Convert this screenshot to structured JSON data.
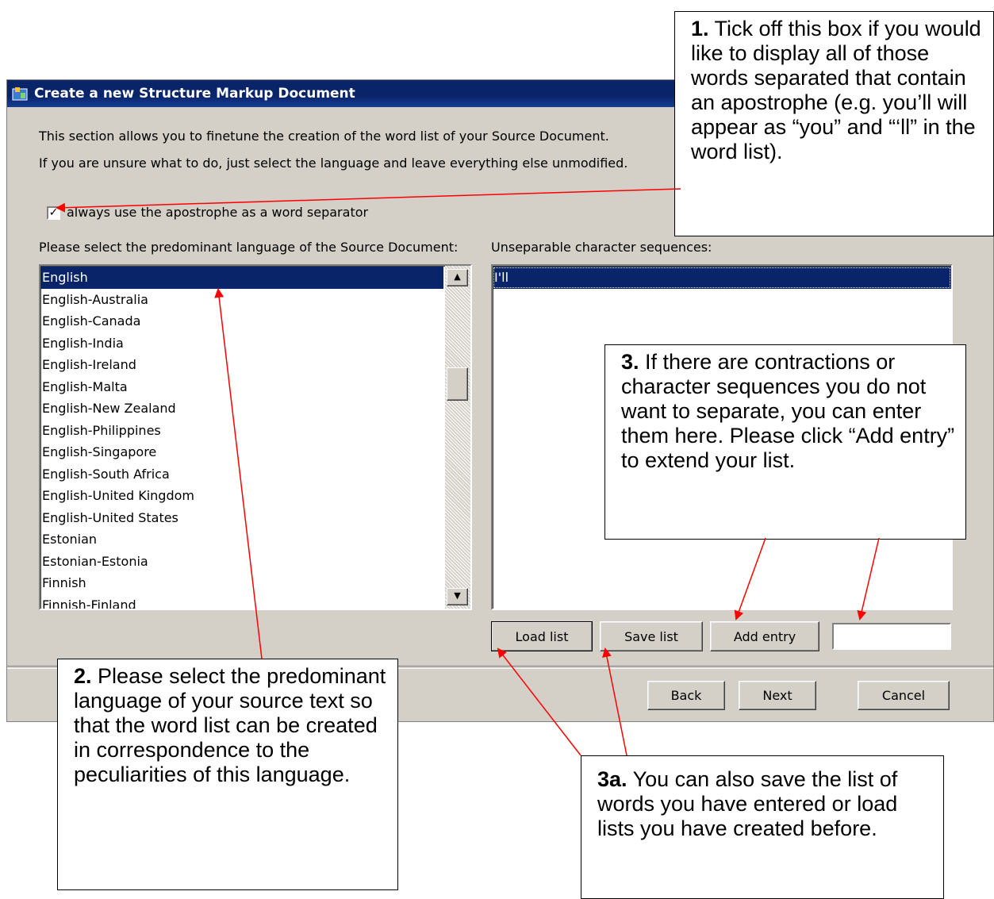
{
  "window": {
    "title": "Create a new Structure Markup Document"
  },
  "intro": {
    "line1": "This section allows you to finetune the creation of the word list of your Source Document.",
    "line2": "If you are unsure what to do, just select the language and leave everything else unmodified."
  },
  "apostrophe_option": {
    "label": "always use the apostrophe as a word separator",
    "checked": true,
    "check_glyph": "✓"
  },
  "language_panel": {
    "label": "Please select the predominant language of the Source Document:",
    "items": [
      "English",
      "English-Australia",
      "English-Canada",
      "English-India",
      "English-Ireland",
      "English-Malta",
      "English-New Zealand",
      "English-Philippines",
      "English-Singapore",
      "English-South Africa",
      "English-United Kingdom",
      "English-United States",
      "Estonian",
      "Estonian-Estonia",
      "Finnish",
      "Finnish-Finland"
    ],
    "selected": "English"
  },
  "sequences_panel": {
    "label": "Unseparable character sequences:",
    "items": [
      "I'll"
    ]
  },
  "list_buttons": {
    "load": "Load list",
    "save": "Save list",
    "add": "Add entry",
    "entry_value": ""
  },
  "nav_buttons": {
    "back": "Back",
    "next": "Next",
    "cancel": "Cancel"
  },
  "callouts": {
    "c1_num": "1.",
    "c1_text": "Tick off this box if you would like to display all of those words separated that contain an apostrophe (e.g. you’ll will appear as “you” and “‘ll” in the word list).",
    "c2_num": "2.",
    "c2_text": "Please select the predominant language of your source text so that the word list can be created in correspondence to the peculiarities of this language.",
    "c3_num": "3.",
    "c3_text": "If there are contractions or character sequences you do not want to separate, you can enter them here. Please click “Add entry” to extend your list.",
    "c3a_num": "3a.",
    "c3a_text": "You can also save the list of words you have entered or load lists you have created before."
  },
  "colors": {
    "title_bar": "#0a246a",
    "dialog_face": "#d4d0c8",
    "selection": "#0a246a",
    "arrow": "#ff0000"
  }
}
